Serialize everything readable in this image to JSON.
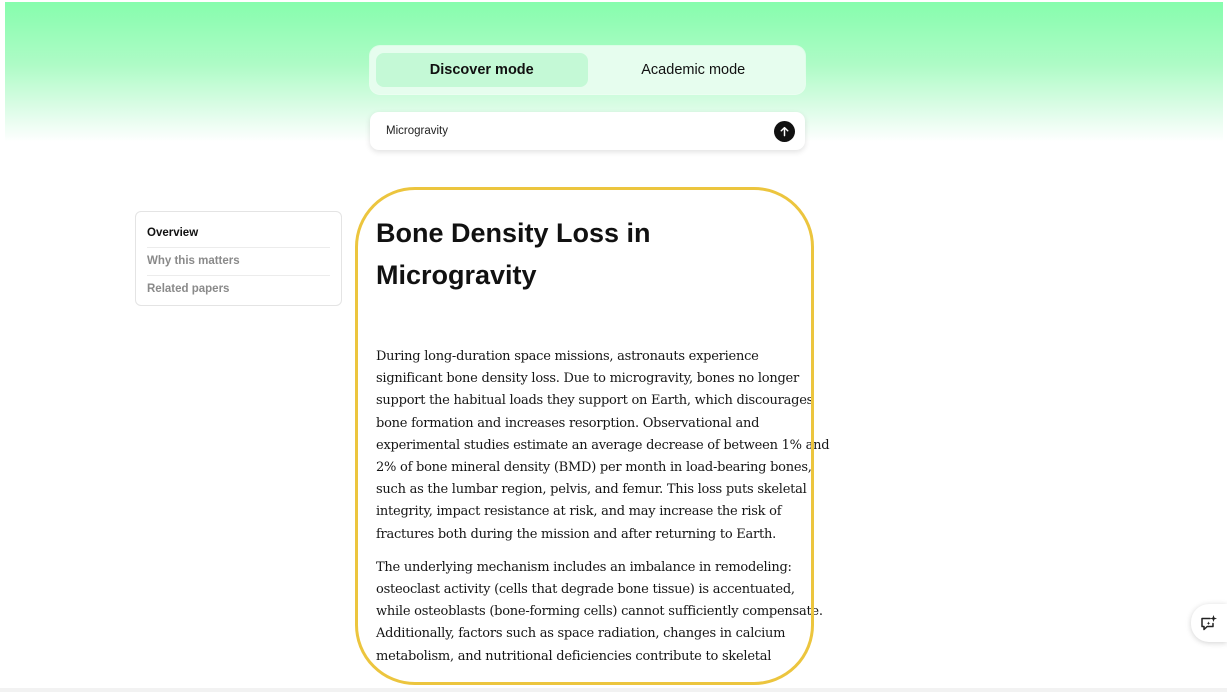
{
  "modes": {
    "discover": "Discover mode",
    "academic": "Academic mode",
    "active": "discover"
  },
  "search": {
    "value": "Microgravity",
    "submit_icon": "arrow-up-icon"
  },
  "toc": {
    "items": [
      {
        "label": "Overview",
        "active": true
      },
      {
        "label": "Why this matters",
        "active": false
      },
      {
        "label": "Related papers",
        "active": false
      }
    ]
  },
  "article": {
    "title": "Bone Density Loss in Microgravity",
    "paragraphs": [
      [
        "During long-duration space missions, astronauts experience",
        "significant bone density loss. Due to microgravity, bones no longer",
        "support the habitual loads they support on Earth, which discourages",
        "bone formation and increases resorption. Observational and",
        "experimental studies estimate an average decrease of between 1% and",
        "2% of bone mineral density (BMD) per month in load-bearing bones,",
        "such as the lumbar region, pelvis, and femur. This loss puts skeletal",
        "integrity, impact resistance at risk, and may increase the risk of",
        "fractures both during the mission and after returning to Earth."
      ],
      [
        "The underlying mechanism includes an imbalance in remodeling:",
        "osteoclast activity (cells that degrade bone tissue) is accentuated,",
        "while osteoblasts (bone-forming cells) cannot sufficiently compensate.",
        "Additionally, factors such as space radiation, changes in calcium",
        "metabolism, and nutritional deficiencies contribute to skeletal"
      ]
    ]
  },
  "assistant": {
    "icon": "sparkle-chat-icon"
  },
  "colors": {
    "highlight": "#ecc53e",
    "gradient_top": "#86fdad",
    "mode_active_bg": "#c4f9d6"
  }
}
